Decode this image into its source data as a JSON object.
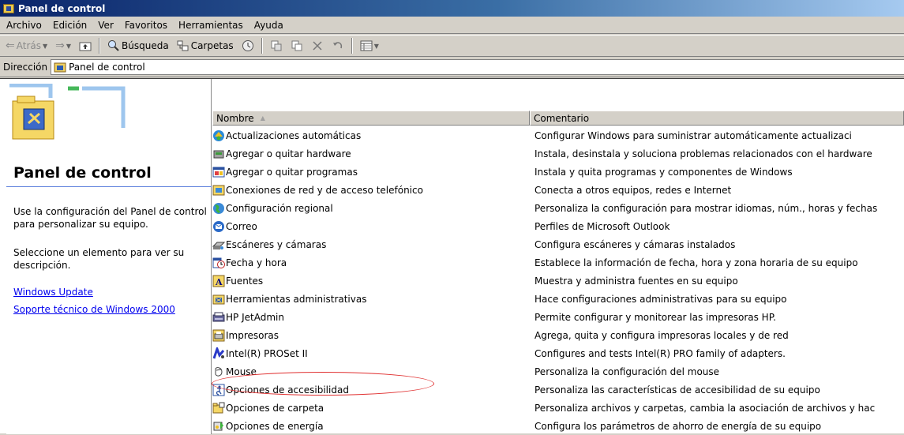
{
  "window": {
    "title": "Panel de control"
  },
  "menu": [
    "Archivo",
    "Edición",
    "Ver",
    "Favoritos",
    "Herramientas",
    "Ayuda"
  ],
  "toolbar": {
    "back": "Atrás",
    "search": "Búsqueda",
    "folders": "Carpetas"
  },
  "address": {
    "label": "Dirección",
    "value": "Panel de control"
  },
  "left": {
    "title": "Panel de control",
    "desc1": "Use la configuración del Panel de control para personalizar su equipo.",
    "desc2": "Seleccione un elemento para ver su descripción.",
    "link1": "Windows Update",
    "link2": "Soporte técnico de Windows 2000"
  },
  "columns": {
    "name": "Nombre",
    "comment": "Comentario"
  },
  "items": [
    {
      "name": "Actualizaciones automáticas",
      "comment": "Configurar Windows para suministrar automáticamente actualizaci",
      "icon": "update-icon"
    },
    {
      "name": "Agregar o quitar hardware",
      "comment": "Instala, desinstala y soluciona problemas relacionados con el hardware",
      "icon": "hardware-icon"
    },
    {
      "name": "Agregar o quitar programas",
      "comment": "Instala y quita programas y componentes de Windows",
      "icon": "programs-icon"
    },
    {
      "name": "Conexiones de red y de acceso telefónico",
      "comment": "Conecta a otros equipos, redes e Internet",
      "icon": "network-icon"
    },
    {
      "name": "Configuración regional",
      "comment": "Personaliza la configuración para mostrar idiomas, núm., horas y fechas",
      "icon": "globe-icon"
    },
    {
      "name": "Correo",
      "comment": "Perfiles de Microsoft Outlook",
      "icon": "mail-icon"
    },
    {
      "name": "Escáneres y cámaras",
      "comment": "Configura escáneres y cámaras instalados",
      "icon": "scanner-icon"
    },
    {
      "name": "Fecha y hora",
      "comment": "Establece la información de fecha, hora y zona horaria de su equipo",
      "icon": "calendar-icon"
    },
    {
      "name": "Fuentes",
      "comment": "Muestra y administra fuentes en su equipo",
      "icon": "font-icon"
    },
    {
      "name": "Herramientas administrativas",
      "comment": "Hace configuraciones administrativas para su equipo",
      "icon": "admin-tools-icon"
    },
    {
      "name": "HP JetAdmin",
      "comment": "Permite configurar y monitorear las impresoras HP.",
      "icon": "hp-icon"
    },
    {
      "name": "Impresoras",
      "comment": "Agrega, quita y configura impresoras locales y de red",
      "icon": "printer-icon"
    },
    {
      "name": "Intel(R) PROSet II",
      "comment": "Configures and tests Intel(R) PRO family of adapters.",
      "icon": "intel-icon"
    },
    {
      "name": "Mouse",
      "comment": "Personaliza la configuración del mouse",
      "icon": "mouse-icon"
    },
    {
      "name": "Opciones de accesibilidad",
      "comment": "Personaliza las características de accesibilidad de su equipo",
      "icon": "accessibility-icon"
    },
    {
      "name": "Opciones de carpeta",
      "comment": "Personaliza archivos y carpetas, cambia la asociación de archivos y hac",
      "icon": "folder-options-icon"
    },
    {
      "name": "Opciones de energía",
      "comment": "Configura los parámetros de ahorro de energía de su equipo",
      "icon": "power-icon"
    }
  ]
}
